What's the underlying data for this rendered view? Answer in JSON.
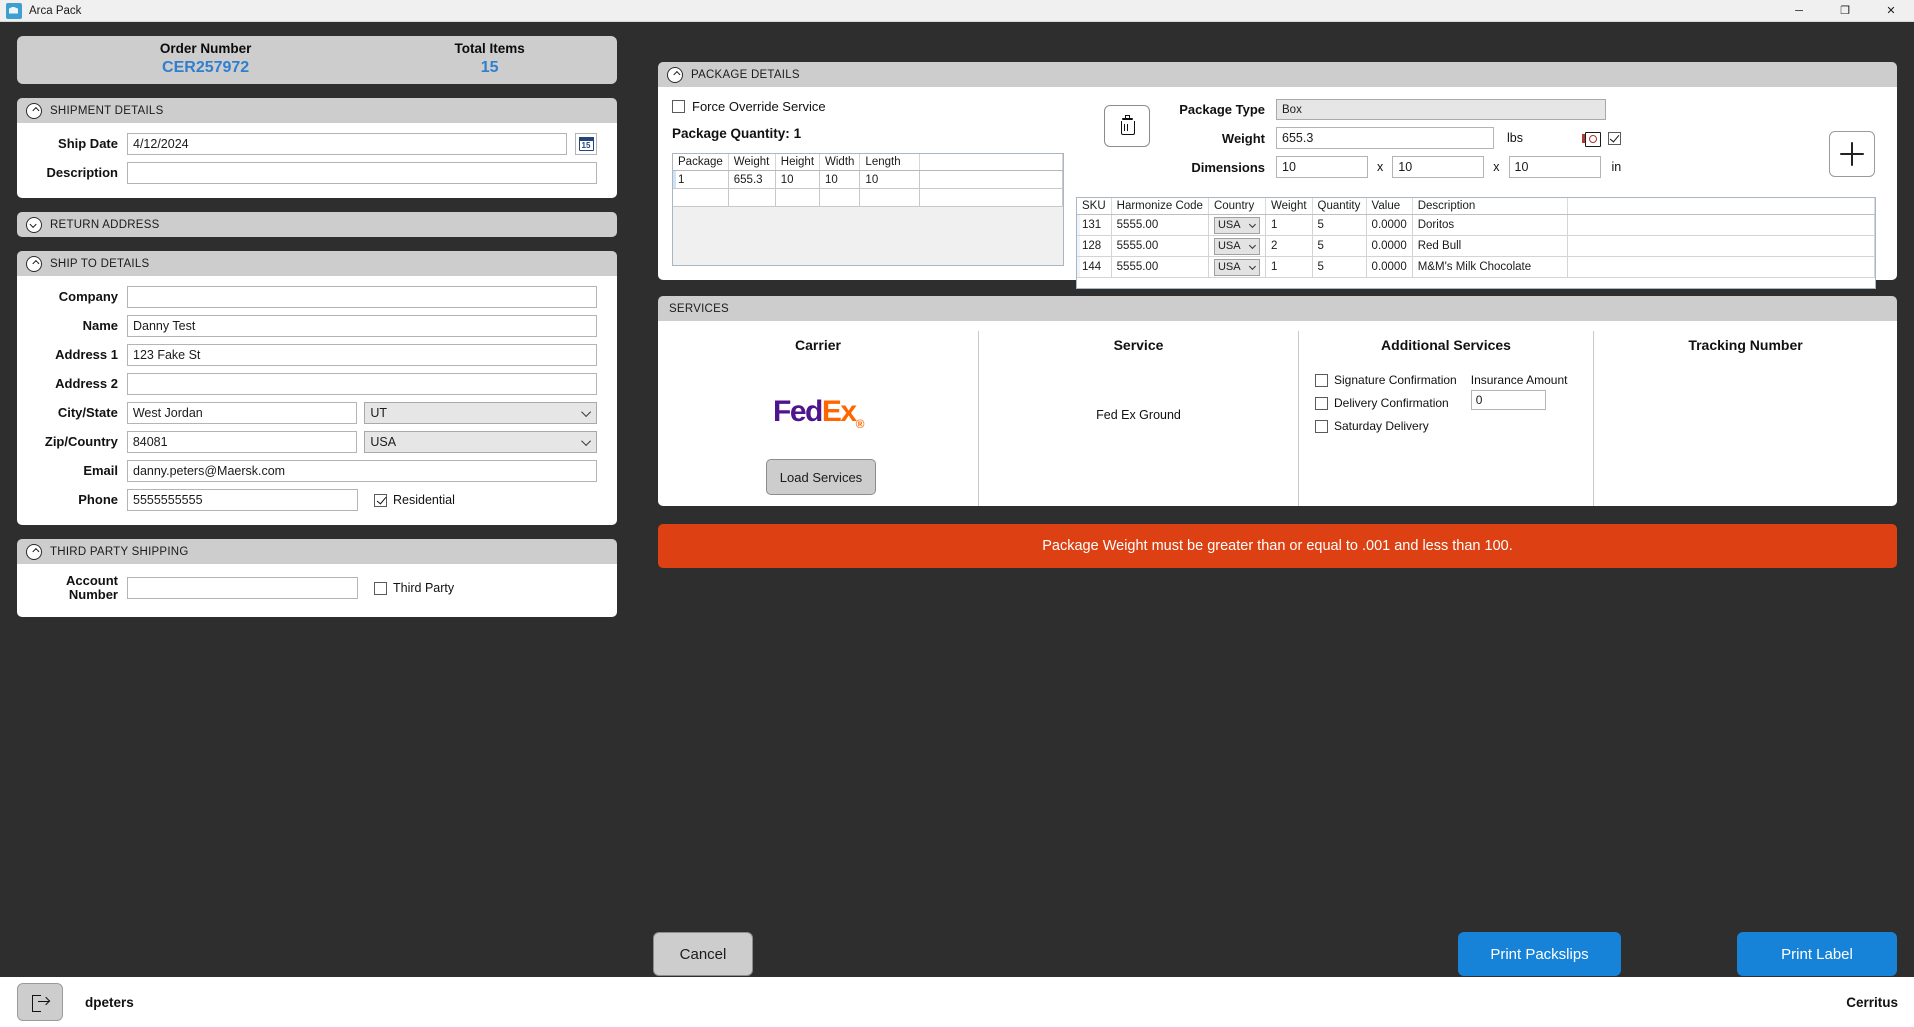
{
  "window": {
    "title": "Arca Pack",
    "minimize_label": "─",
    "maximize_label": "❐",
    "close_label": "✕"
  },
  "order_header": {
    "order_number_label": "Order Number",
    "order_number_value": "CER257972",
    "total_items_label": "Total Items",
    "total_items_value": "15",
    "accent_color": "#2f7fd0"
  },
  "shipment_details": {
    "title": "SHIPMENT DETAILS",
    "ship_date_label": "Ship Date",
    "ship_date_value": "4/12/2024",
    "calendar_day": "15",
    "description_label": "Description",
    "description_value": ""
  },
  "return_address": {
    "title": "RETURN ADDRESS"
  },
  "ship_to": {
    "title": "SHIP TO DETAILS",
    "company_label": "Company",
    "company_value": "",
    "name_label": "Name",
    "name_value": "Danny Test",
    "address1_label": "Address 1",
    "address1_value": "123 Fake St",
    "address2_label": "Address 2",
    "address2_value": "",
    "city_state_label": "City/State",
    "city_value": "West Jordan",
    "state_value": "UT",
    "zip_country_label": "Zip/Country",
    "zip_value": "84081",
    "country_value": "USA",
    "email_label": "Email",
    "email_value": "danny.peters@Maersk.com",
    "phone_label": "Phone",
    "phone_value": "5555555555",
    "residential_label": "Residential",
    "residential_checked": true
  },
  "third_party": {
    "title": "THIRD PARTY SHIPPING",
    "account_number_label": "Account Number",
    "account_number_value": "",
    "third_party_label": "Third Party",
    "third_party_checked": false
  },
  "package_details": {
    "title": "PACKAGE DETAILS",
    "force_override_label": "Force Override Service",
    "force_override_checked": false,
    "package_quantity_label": "Package Quantity:",
    "package_quantity_value": "1",
    "delete_button": "delete-package",
    "add_button": "add-package",
    "grid_headers": [
      "Package",
      "Weight",
      "Height",
      "Width",
      "Length"
    ],
    "grid_rows": [
      [
        "1",
        "655.3",
        "10",
        "10",
        "10"
      ]
    ],
    "package_type_label": "Package Type",
    "package_type_value": "Box",
    "weight_label": "Weight",
    "weight_value": "655.3",
    "weight_unit": "lbs",
    "scale_checked": true,
    "dimensions_label": "Dimensions",
    "dim_length": "10",
    "dim_width": "10",
    "dim_height": "10",
    "dim_x": "x",
    "dim_unit": "in"
  },
  "sku_table": {
    "headers": [
      "SKU",
      "Harmonize Code",
      "Country",
      "Weight",
      "Quantity",
      "Value",
      "Description"
    ],
    "rows": [
      {
        "sku": "131",
        "harmonize_code": "5555.00",
        "country": "USA",
        "weight": "1",
        "quantity": "5",
        "value": "0.0000",
        "description": "Doritos"
      },
      {
        "sku": "128",
        "harmonize_code": "5555.00",
        "country": "USA",
        "weight": "2",
        "quantity": "5",
        "value": "0.0000",
        "description": "Red Bull"
      },
      {
        "sku": "144",
        "harmonize_code": "5555.00",
        "country": "USA",
        "weight": "1",
        "quantity": "5",
        "value": "0.0000",
        "description": "M&M's Milk Chocolate"
      }
    ]
  },
  "services": {
    "title": "SERVICES",
    "carrier_header": "Carrier",
    "carrier_logo_fed": "Fed",
    "carrier_logo_ex": "Ex",
    "service_header": "Service",
    "service_name": "Fed Ex Ground",
    "additional_header": "Additional Services",
    "signature_label": "Signature Confirmation",
    "signature_checked": false,
    "delivery_label": "Delivery Confirmation",
    "delivery_checked": false,
    "saturday_label": "Saturday Delivery",
    "saturday_checked": false,
    "insurance_label": "Insurance Amount",
    "insurance_value": "0",
    "tracking_header": "Tracking Number",
    "tracking_value": "",
    "load_services_label": "Load Services"
  },
  "error": {
    "message": "Package Weight must be greater than or equal to .001 and less than 100.",
    "color": "#dd4113"
  },
  "actions": {
    "cancel_label": "Cancel",
    "print_packslips_label": "Print Packslips",
    "print_label_label": "Print Label",
    "primary_color": "#1683d8"
  },
  "taskbar": {
    "logout_icon": "logout-icon",
    "user": "dpeters",
    "site": "Cerritus"
  }
}
